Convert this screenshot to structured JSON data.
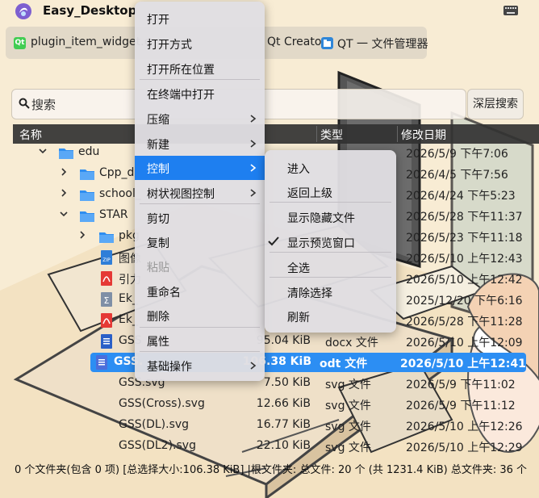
{
  "window": {
    "title": "Easy_Desktop",
    "logo_icon": "app-logo-icon",
    "keyboard_icon": "keyboard-icon"
  },
  "quickbar": {
    "items": [
      {
        "label": "plugin_item_widget.c",
        "icon": "qt-icon"
      },
      {
        "label": "Qt Creator",
        "icon": "qt-icon"
      },
      {
        "label": "QT 一 文件管理器",
        "icon": "file-manager-icon"
      }
    ]
  },
  "search": {
    "placeholder": "搜索",
    "deep_search_label": "深层搜索"
  },
  "columns": {
    "name": "名称",
    "type": "类型",
    "modified": "修改日期"
  },
  "rows": [
    {
      "name": "edu",
      "size": "",
      "type": "",
      "date": "2026/5/9 下午7:06",
      "icon": "folder-icon",
      "expanded": true
    },
    {
      "name": "Cpp_d",
      "size": "",
      "type": "",
      "date": "2026/4/5 下午7:56",
      "icon": "folder-icon",
      "expanded": false
    },
    {
      "name": "school_",
      "size": "",
      "type": "",
      "date": "2026/4/24 下午5:23",
      "icon": "folder-icon",
      "expanded": false
    },
    {
      "name": "STAR",
      "size": "",
      "type": "",
      "date": "2026/5/28 下午11:37",
      "icon": "folder-icon",
      "expanded": true
    },
    {
      "name": "pkg",
      "size": "",
      "type": "",
      "date": "2026/5/23 下午11:18",
      "icon": "folder-icon",
      "expanded": false
    },
    {
      "name": "图像",
      "size": "",
      "type": "",
      "date": "2026/5/10 上午12:43",
      "icon": "zip-icon"
    },
    {
      "name": "引力",
      "size": "",
      "type": "",
      "date": "2026/5/10 上午12:42",
      "icon": "pdf-icon"
    },
    {
      "name": "Ek_",
      "size": "",
      "type": "",
      "date": "2025/12/20 下午6:16",
      "icon": "sigma-icon"
    },
    {
      "name": "Ek_",
      "size": "",
      "type": "",
      "date": "2026/5/28 下午11:28",
      "icon": "pdf-icon"
    },
    {
      "name": "GSS",
      "size": "95.04 KiB",
      "type": "docx 文件",
      "date": "2026/5/10 上午12:09",
      "icon": "docx-icon"
    },
    {
      "name": "GSS.",
      "size": "106.38 KiB",
      "type": "odt 文件",
      "date": "2026/5/10 上午12:41",
      "icon": "odt-icon",
      "selected": true
    },
    {
      "name": "GSS.svg",
      "size": "7.50 KiB",
      "type": "svg 文件",
      "date": "2026/5/9 下午11:02",
      "icon": "svg-icon"
    },
    {
      "name": "GSS(Cross).svg",
      "size": "12.66 KiB",
      "type": "svg 文件",
      "date": "2026/5/9 下午11:12",
      "icon": "svg-icon"
    },
    {
      "name": "GSS(DL).svg",
      "size": "16.77 KiB",
      "type": "svg 文件",
      "date": "2026/5/10 上午12:26",
      "icon": "svg-icon"
    },
    {
      "name": "GSS(DL2).svg",
      "size": "22.10 KiB",
      "type": "svg 文件",
      "date": "2026/5/10 上午12:29",
      "icon": "svg-icon"
    }
  ],
  "status": "0 个文件夹(包含 0 项) [总选择大小:106.38 KiB] |根文件夹: 总文件: 20 个 (共 1231.4 KiB)  总文件夹: 36 个",
  "context_menu": {
    "items": [
      {
        "label": "打开"
      },
      {
        "label": "打开方式"
      },
      {
        "label": "打开所在位置"
      },
      {
        "label": "在终端中打开"
      },
      {
        "label": "压缩",
        "submenu": true
      },
      {
        "label": "新建",
        "submenu": true
      },
      {
        "label": "控制",
        "submenu": true,
        "highlighted": true
      },
      {
        "label": "树状视图控制",
        "submenu": true
      },
      {
        "label": "剪切"
      },
      {
        "label": "复制"
      },
      {
        "label": "粘贴",
        "disabled": true
      },
      {
        "label": "重命名"
      },
      {
        "label": "删除"
      },
      {
        "label": "属性"
      },
      {
        "label": "基础操作",
        "submenu": true
      }
    ]
  },
  "control_submenu": {
    "items": [
      {
        "label": "进入"
      },
      {
        "label": "返回上级"
      },
      {
        "label": "显示隐藏文件"
      },
      {
        "label": "显示预览窗口",
        "checked": true
      },
      {
        "label": "全选"
      },
      {
        "label": "清除选择"
      },
      {
        "label": "刷新"
      }
    ]
  },
  "colors": {
    "accent": "#1e7ff0",
    "selection": "#2c8ef3",
    "header_bg": "#323232"
  }
}
